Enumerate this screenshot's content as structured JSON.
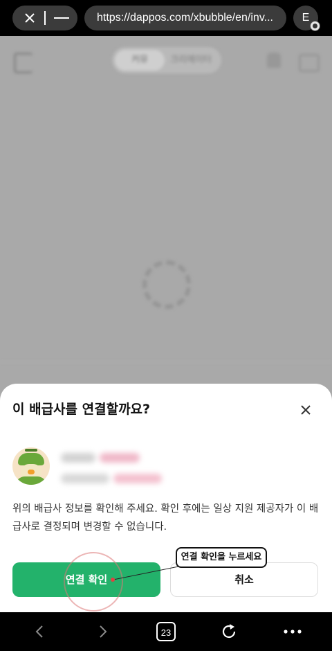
{
  "browser": {
    "url": "https://dappos.com/xbubble/en/inv...",
    "extension_label": "E",
    "tab_count": "23"
  },
  "page_bg": {
    "segment_left": "커뮤",
    "segment_right": "크리에이터"
  },
  "dialog": {
    "title": "이 배급사를 연결할까요?",
    "description": "위의 배급사 정보를 확인해 주세요. 확인 후에는 일상 지원 제공자가 이 배급사로 결정되며 변경할 수 없습니다.",
    "confirm_label": "연결 확인",
    "cancel_label": "취소",
    "annotation_label": "연결 확인을 누르세요"
  },
  "colors": {
    "confirm_green": "#23b26b",
    "overlay_gray": "#a9a9a9"
  },
  "icons": [
    "close-icon",
    "minimize-icon",
    "extension-icon",
    "sheet-close-icon",
    "back-icon",
    "forward-icon",
    "tabs-icon",
    "reload-icon",
    "more-icon"
  ]
}
